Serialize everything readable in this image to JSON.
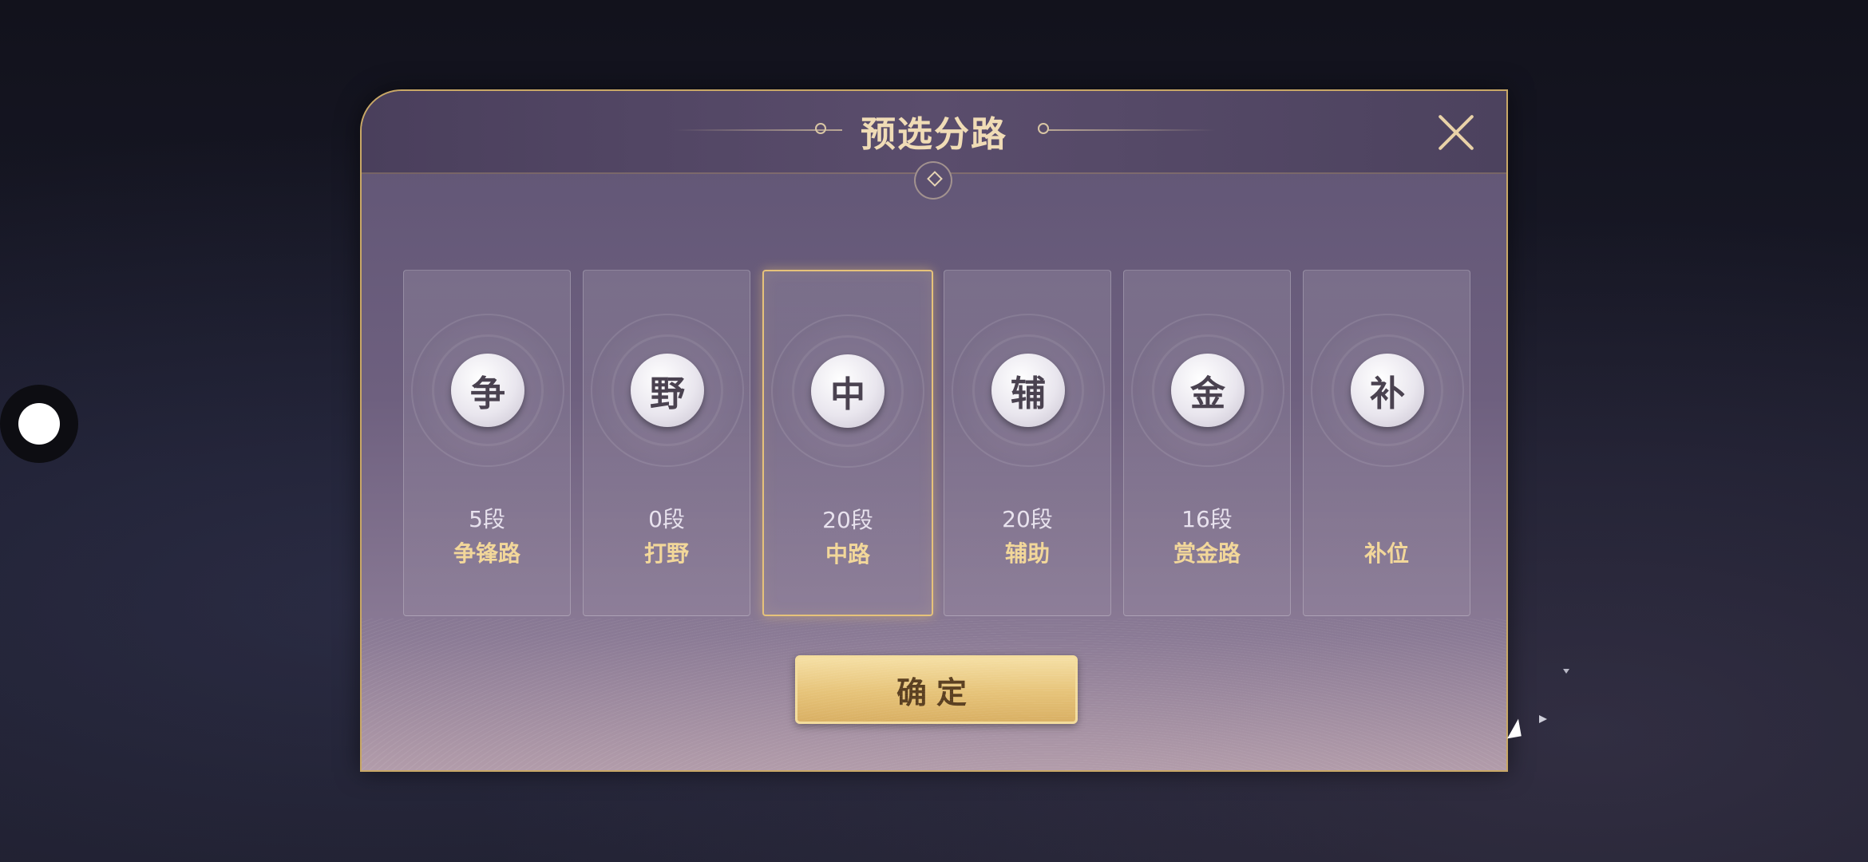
{
  "dialog": {
    "title": "预选分路",
    "close_icon": "close-icon"
  },
  "lanes": [
    {
      "icon_char": "争",
      "rank": "5段",
      "name": "争锋路",
      "selected": false
    },
    {
      "icon_char": "野",
      "rank": "0段",
      "name": "打野",
      "selected": false
    },
    {
      "icon_char": "中",
      "rank": "20段",
      "name": "中路",
      "selected": true
    },
    {
      "icon_char": "辅",
      "rank": "20段",
      "name": "辅助",
      "selected": false
    },
    {
      "icon_char": "金",
      "rank": "16段",
      "name": "赏金路",
      "selected": false
    },
    {
      "icon_char": "补",
      "rank": "",
      "name": "补位",
      "selected": false
    }
  ],
  "confirm": {
    "label": "确定"
  },
  "colors": {
    "accent_gold": "#e6c27a",
    "lane_name": "#f2d79a",
    "title": "#f0dcb6"
  }
}
